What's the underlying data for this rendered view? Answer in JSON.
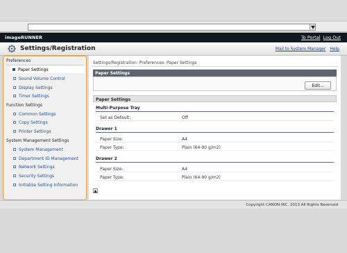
{
  "browser": {
    "address_value": ""
  },
  "header": {
    "brand": "imageRUNNER",
    "to_portal": "To Portal",
    "log_out": "Log Out",
    "title": "Settings/Registration",
    "mail_admin": "Mail to System Manager",
    "help": "Help"
  },
  "sidebar": {
    "preferences": {
      "label": "Preferences",
      "items": [
        "Paper Settings",
        "Sound Volume Control",
        "Display Settings",
        "Timer Settings"
      ]
    },
    "function_settings": {
      "label": "Function Settings",
      "items": [
        "Common Settings",
        "Copy Settings",
        "Printer Settings"
      ]
    },
    "system_management": {
      "label": "System Management Settings",
      "items": [
        "System Management",
        "Department ID Management",
        "Network Settings",
        "Security Settings",
        "Initialize Setting Information"
      ]
    }
  },
  "content": {
    "breadcrumb": "Settings/Registration: Preferences: Paper Settings",
    "panel_title": "Paper Settings",
    "edit_label": "Edit...",
    "section_title": "Paper Settings",
    "mp_tray": {
      "title": "Multi-Purpose Tray",
      "rows": [
        {
          "k": "Set as Default:",
          "v": "Off"
        }
      ]
    },
    "drawer1": {
      "title": "Drawer 1",
      "rows": [
        {
          "k": "Paper Size:",
          "v": "A4"
        },
        {
          "k": "Paper Type:",
          "v": "Plain (64-90 g/m2)"
        }
      ]
    },
    "drawer2": {
      "title": "Drawer 2",
      "rows": [
        {
          "k": "Paper Size:",
          "v": "A4"
        },
        {
          "k": "Paper Type:",
          "v": "Plain (64-90 g/m2)"
        }
      ]
    }
  },
  "footer": {
    "copyright": "Copyright CANON INC. 2013 All Rights Reserved"
  },
  "colors": {
    "accent_border": "#f39c3a",
    "header_dark": "#101820",
    "panel_head": "#5d6470",
    "link": "#1f4f8f"
  }
}
